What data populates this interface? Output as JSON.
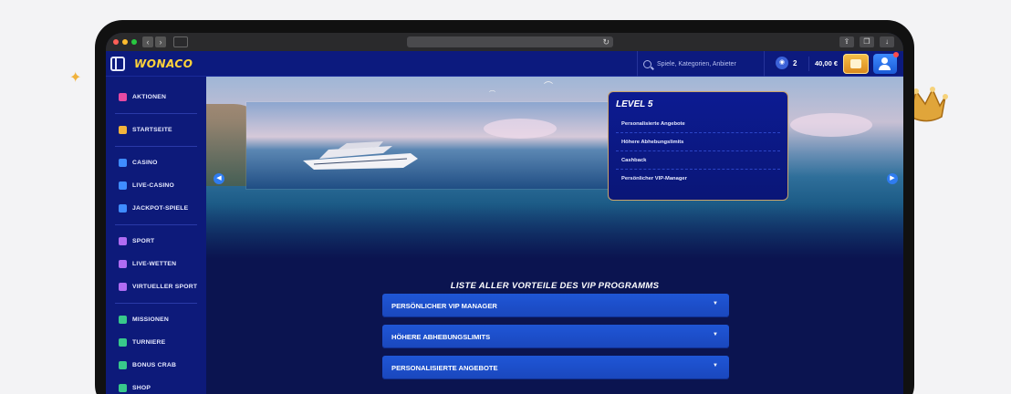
{
  "header": {
    "logo": "WONACO",
    "search_placeholder": "Spiele, Kategorien, Anbieter",
    "coin_count": "2",
    "balance": "40,00 €"
  },
  "sidebar": {
    "items": [
      {
        "label": "AKTIONEN",
        "icon": "gift-icon",
        "color": "#e64aa3"
      },
      {
        "label": "STARTSEITE",
        "icon": "home-icon",
        "color": "#f2b43c"
      },
      {
        "label": "CASINO",
        "icon": "slot-machine-icon",
        "color": "#3f8cff"
      },
      {
        "label": "LIVE-CASINO",
        "icon": "live-casino-icon",
        "color": "#3f8cff"
      },
      {
        "label": "JACKPOT-SPIELE",
        "icon": "jackpot-icon",
        "color": "#3f8cff"
      },
      {
        "label": "SPORT",
        "icon": "sport-icon",
        "color": "#b06cf2"
      },
      {
        "label": "LIVE-WETTEN",
        "icon": "live-betting-icon",
        "color": "#b06cf2"
      },
      {
        "label": "VIRTUELLER SPORT",
        "icon": "virtual-sport-icon",
        "color": "#b06cf2"
      },
      {
        "label": "MISSIONEN",
        "icon": "missions-icon",
        "color": "#38c98b"
      },
      {
        "label": "TURNIERE",
        "icon": "tournament-icon",
        "color": "#38c98b"
      },
      {
        "label": "BONUS CRAB",
        "icon": "bonus-crab-icon",
        "color": "#38c98b"
      },
      {
        "label": "SHOP",
        "icon": "shop-icon",
        "color": "#38c98b"
      }
    ]
  },
  "level_card": {
    "title": "LEVEL 5",
    "rows": [
      "Personalisierte Angebote",
      "Höhere Abhebungslimits",
      "Cashback",
      "Persönlicher VIP-Manager"
    ]
  },
  "benefits": {
    "title": "LISTE ALLER VORTEILE DES VIP PROGRAMMS",
    "items": [
      "PERSÖNLICHER VIP MANAGER",
      "HÖHERE ABHEBUNGSLIMITS",
      "PERSONALISIERTE ANGEBOTE"
    ]
  }
}
